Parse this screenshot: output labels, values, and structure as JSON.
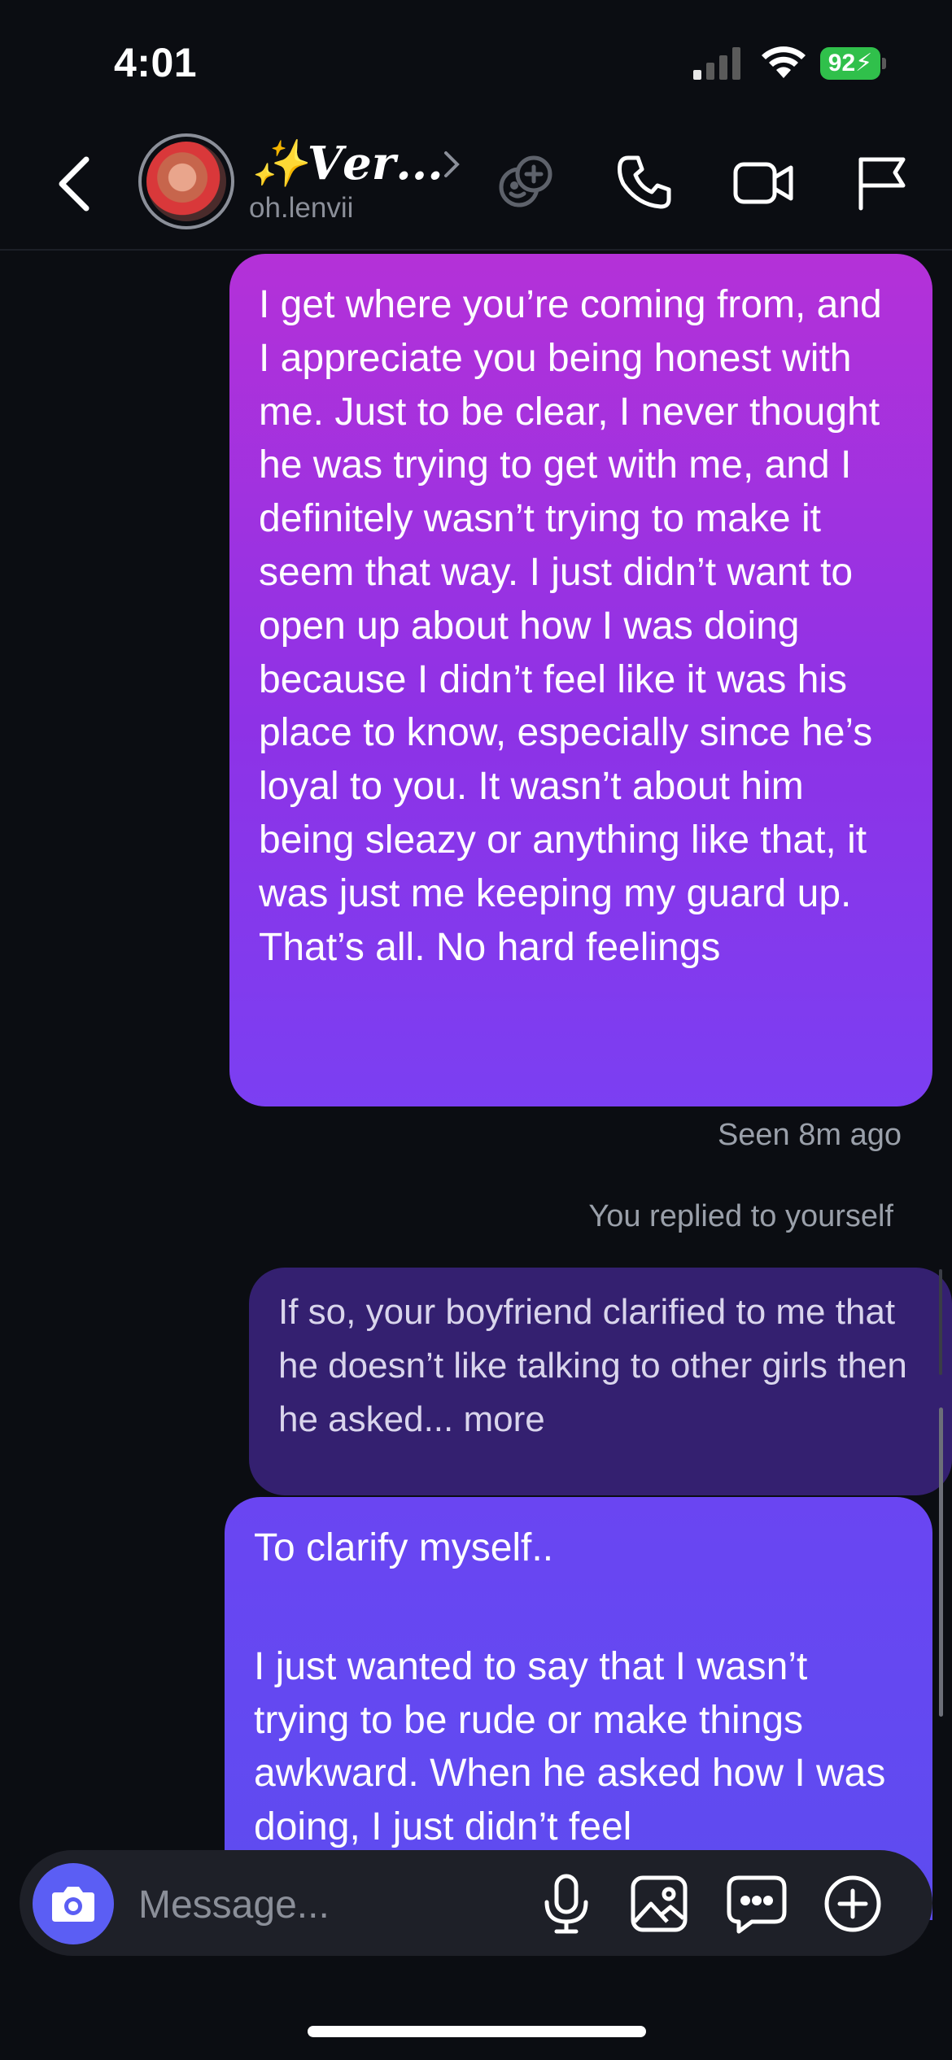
{
  "status_bar": {
    "time": "4:01",
    "battery": "92"
  },
  "header": {
    "name": "✨𝑽𝒆𝒓...",
    "username": "oh.lenvii"
  },
  "messages": [
    {
      "text": "I get where you’re coming from, and I appreciate you being honest with me. Just to be clear, I never thought he was trying to get with me, and I definitely wasn’t trying to make it seem that way. I just didn’t want to open up about how I was doing because I didn’t feel like it was his place to know, especially since he’s loyal to you. It wasn’t about him being sleazy or anything like that, it was just me keeping my guard up. That’s all. No hard feelings"
    }
  ],
  "seen_status": "Seen 8m ago",
  "reply_context": "You replied to yourself",
  "quoted_reply": "If so, your boyfriend clarified to me that he doesn’t like talking to other girls then he asked... more",
  "last_message": {
    "line1": "To clarify myself..",
    "line2": " I just wanted to say that I wasn’t trying to be rude or make things awkward. When he asked how I was doing, I just didn’t feel"
  },
  "composer": {
    "placeholder": "Message..."
  },
  "colors": {
    "background": "#0b0d12",
    "bubble_gradient_top": "#b431d8",
    "bubble_gradient_bottom": "#7b3ff2",
    "quoted_bubble": "#342070",
    "last_bubble": "#6a45f2",
    "camera_button": "#5b5ef4",
    "battery": "#30c04b"
  },
  "icons": [
    "back-icon",
    "chevron-right-icon",
    "add-effect-icon",
    "phone-icon",
    "video-icon",
    "flag-icon",
    "camera-icon",
    "microphone-icon",
    "gallery-icon",
    "chat-options-icon",
    "plus-circle-icon",
    "signal-icon",
    "wifi-icon",
    "battery-icon"
  ]
}
